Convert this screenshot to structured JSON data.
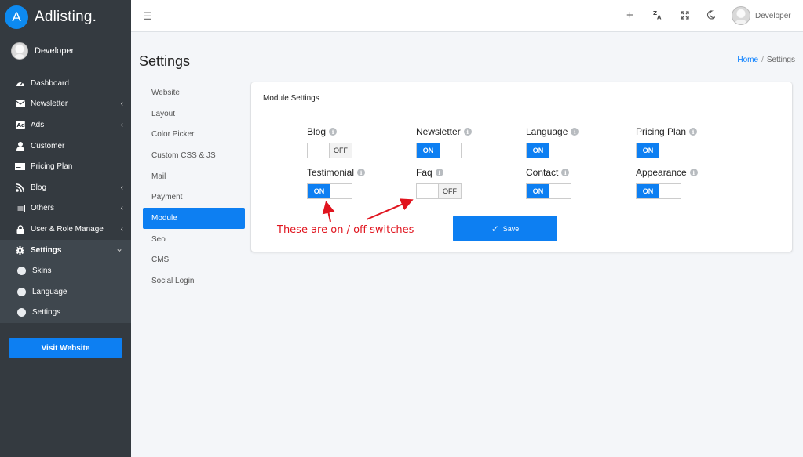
{
  "app": {
    "logo_letter": "A",
    "name": "Adlisting."
  },
  "user": {
    "name": "Developer"
  },
  "sidebar": {
    "items": [
      {
        "label": "Dashboard",
        "icon": "dashboard-icon",
        "chevron": ""
      },
      {
        "label": "Newsletter",
        "icon": "envelope-icon",
        "chevron": "‹"
      },
      {
        "label": "Ads",
        "icon": "ad-icon",
        "chevron": "‹"
      },
      {
        "label": "Customer",
        "icon": "user-icon",
        "chevron": ""
      },
      {
        "label": "Pricing Plan",
        "icon": "money-icon",
        "chevron": ""
      },
      {
        "label": "Blog",
        "icon": "blog-icon",
        "chevron": "‹"
      },
      {
        "label": "Others",
        "icon": "list-icon",
        "chevron": "‹"
      },
      {
        "label": "User & Role Manage",
        "icon": "lock-icon",
        "chevron": "‹"
      },
      {
        "label": "Settings",
        "icon": "gear-icon",
        "chevron": "⌄"
      }
    ],
    "sub_items": [
      {
        "label": "Skins"
      },
      {
        "label": "Language"
      },
      {
        "label": "Settings"
      }
    ],
    "visit_button": "Visit Website"
  },
  "topbar": {
    "icons": [
      "plus-icon",
      "translate-icon",
      "fullscreen-icon",
      "moon-icon"
    ],
    "user_name": "Developer"
  },
  "page": {
    "title": "Settings",
    "breadcrumb": {
      "home": "Home",
      "separator": "/",
      "current": "Settings"
    }
  },
  "settings_menu": [
    {
      "label": "Website"
    },
    {
      "label": "Layout"
    },
    {
      "label": "Color Picker"
    },
    {
      "label": "Custom CSS & JS"
    },
    {
      "label": "Mail"
    },
    {
      "label": "Payment"
    },
    {
      "label": "Module",
      "active": true
    },
    {
      "label": "Seo"
    },
    {
      "label": "CMS"
    },
    {
      "label": "Social Login"
    }
  ],
  "card": {
    "title": "Module Settings",
    "modules": [
      {
        "label": "Blog",
        "state": "OFF"
      },
      {
        "label": "Newsletter",
        "state": "ON"
      },
      {
        "label": "Language",
        "state": "ON"
      },
      {
        "label": "Pricing Plan",
        "state": "ON"
      },
      {
        "label": "Testimonial",
        "state": "ON"
      },
      {
        "label": "Faq",
        "state": "OFF"
      },
      {
        "label": "Contact",
        "state": "ON"
      },
      {
        "label": "Appearance",
        "state": "ON"
      }
    ],
    "save_label": "Save"
  },
  "annotation": {
    "text": "These are on / off switches",
    "color": "#e0141e"
  },
  "colors": {
    "accent": "#0d7ff2",
    "sidebar_bg": "#343a40"
  }
}
